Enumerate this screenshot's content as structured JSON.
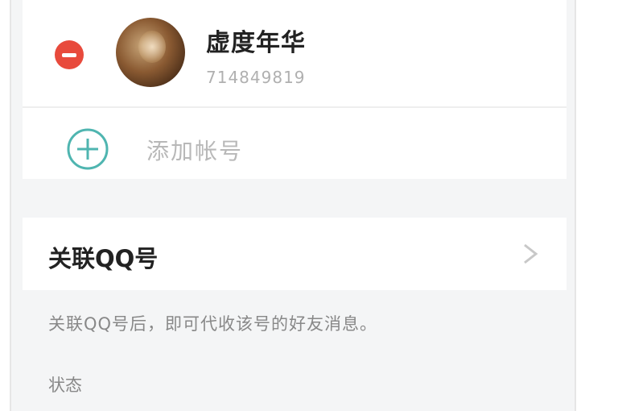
{
  "account": {
    "name": "虚度年华",
    "id": "714849819",
    "remove_icon": "minus-circle-icon",
    "avatar_icon": "avatar-image"
  },
  "add_account": {
    "label": "添加帐号",
    "icon": "plus-circle-icon",
    "icon_color": "#4fb5b0"
  },
  "link_qq": {
    "label": "关联QQ号",
    "chevron_icon": "chevron-right-icon"
  },
  "hint_text": "关联QQ号后，即可代收该号的好友消息。",
  "status_label": "状态",
  "colors": {
    "remove_red": "#e84a3c",
    "background": "#f4f5f6"
  }
}
